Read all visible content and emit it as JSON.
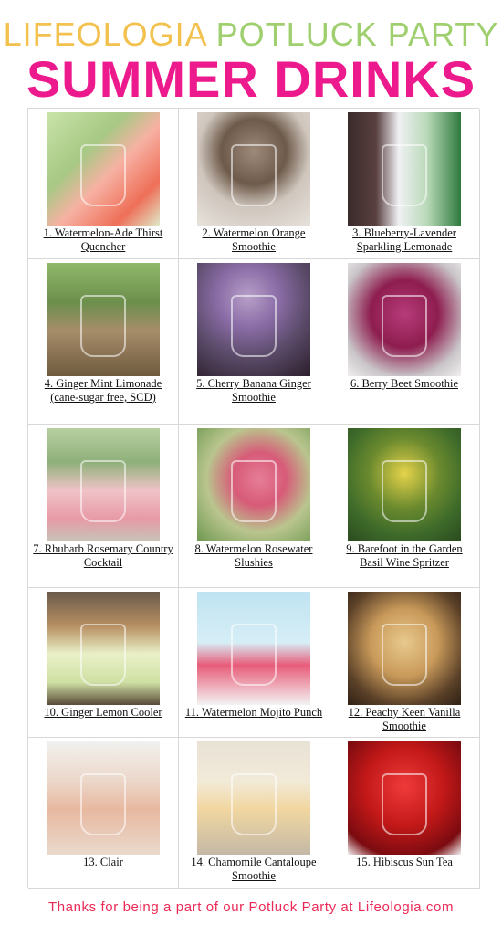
{
  "header": {
    "brand": "LIFEOLOGIA",
    "subtitle": "POTLUCK PARTY",
    "title": "SUMMER DRINKS"
  },
  "drinks": [
    {
      "caption": "1. Watermelon-Ade Thirst Quencher",
      "image": "watermelon-ade-photo"
    },
    {
      "caption": "2. Watermelon Orange Smoothie",
      "image": "watermelon-orange-smoothie-photo"
    },
    {
      "caption": "3. Blueberry-Lavender Sparkling Lemonade",
      "image": "blueberry-lavender-lemonade-photo"
    },
    {
      "caption": "4. Ginger Mint Limonade (cane-sugar free, SCD)",
      "image": "ginger-mint-limonade-photo"
    },
    {
      "caption": "5. Cherry Banana Ginger Smoothie",
      "image": "cherry-banana-smoothie-photo"
    },
    {
      "caption": "6. Berry Beet Smoothie",
      "image": "berry-beet-smoothie-photo"
    },
    {
      "caption": "7. Rhubarb Rosemary Country Cocktail",
      "image": "rhubarb-rosemary-cocktail-photo"
    },
    {
      "caption": "8. Watermelon Rosewater Slushies",
      "image": "watermelon-rosewater-slushie-photo"
    },
    {
      "caption": "9. Barefoot in the Garden Basil Wine Spritzer",
      "image": "basil-wine-spritzer-photo"
    },
    {
      "caption": "10. Ginger Lemon Cooler",
      "image": "ginger-lemon-cooler-photo"
    },
    {
      "caption": "11. Watermelon Mojito Punch",
      "image": "watermelon-mojito-punch-photo"
    },
    {
      "caption": "12. Peachy Keen Vanilla Smoothie",
      "image": "peachy-keen-smoothie-photo"
    },
    {
      "caption": "13. Clair",
      "image": "clair-drink-photo"
    },
    {
      "caption": "14. Chamomile Cantaloupe Smoothie",
      "image": "chamomile-cantaloupe-smoothie-photo"
    },
    {
      "caption": "15. Hibiscus Sun Tea",
      "image": "hibiscus-sun-tea-photo"
    }
  ],
  "footer": {
    "text": "Thanks for being a part of our Potluck Party at Lifeologia.com"
  },
  "colors": {
    "brand": "#f2c14e",
    "subtitle": "#9fcf6f",
    "title": "#ec1a8c",
    "footer": "#ec2a57"
  }
}
